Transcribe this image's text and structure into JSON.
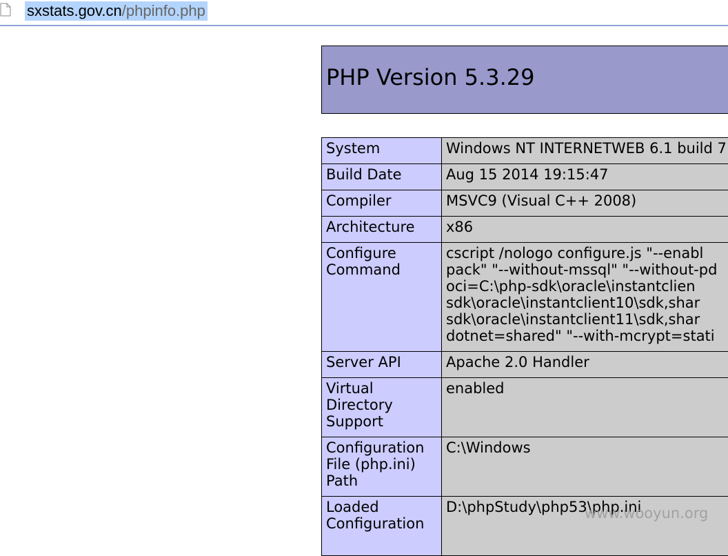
{
  "browser": {
    "url_host": "sxstats.gov.cn",
    "url_path": "/phpinfo.php",
    "icon": "page-icon"
  },
  "header": {
    "title": "PHP Version 5.3.29",
    "bg_color": "#9999cc"
  },
  "rows": {
    "system": {
      "label": "System",
      "value": "Windows NT INTERNETWEB 6.1 build 7"
    },
    "build_date": {
      "label": "Build Date",
      "value": "Aug 15 2014 19:15:47"
    },
    "compiler": {
      "label": "Compiler",
      "value": "MSVC9 (Visual C++ 2008)"
    },
    "architecture": {
      "label": "Architecture",
      "value": "x86"
    },
    "configure_command": {
      "label": "Configure Command",
      "lines": [
        "cscript /nologo configure.js \"--enabl",
        "pack\" \"--without-mssql\" \"--without-pd",
        "oci=C:\\php-sdk\\oracle\\instantclien",
        "sdk\\oracle\\instantclient10\\sdk,shar",
        "sdk\\oracle\\instantclient11\\sdk,shar",
        "dotnet=shared\" \"--with-mcrypt=stati"
      ]
    },
    "server_api": {
      "label": "Server API",
      "value": "Apache 2.0 Handler"
    },
    "virtual_directory": {
      "label": "Virtual Directory Support",
      "value": "enabled"
    },
    "config_file_path": {
      "label": "Configuration File (php.ini) Path",
      "value": "C:\\Windows"
    },
    "loaded_config": {
      "label": "Loaded Configuration",
      "value": "D:\\phpStudy\\php53\\php.ini"
    }
  },
  "colors": {
    "label_cell": "#ccccff",
    "value_cell": "#cccccc",
    "url_highlight": "#b3d4fc"
  },
  "watermark": "www.wooyun.org"
}
